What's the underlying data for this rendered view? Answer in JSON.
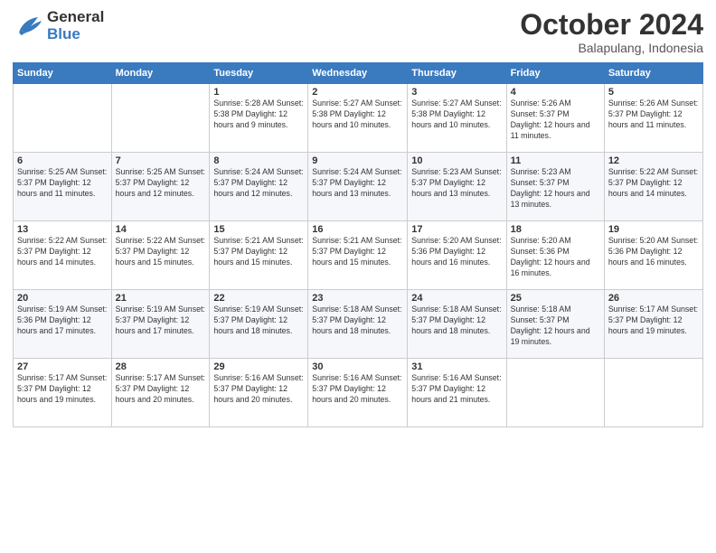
{
  "header": {
    "logo_line1": "General",
    "logo_line2": "Blue",
    "month": "October 2024",
    "location": "Balapulang, Indonesia"
  },
  "weekdays": [
    "Sunday",
    "Monday",
    "Tuesday",
    "Wednesday",
    "Thursday",
    "Friday",
    "Saturday"
  ],
  "weeks": [
    [
      {
        "day": "",
        "info": ""
      },
      {
        "day": "",
        "info": ""
      },
      {
        "day": "1",
        "info": "Sunrise: 5:28 AM\nSunset: 5:38 PM\nDaylight: 12 hours and 9 minutes."
      },
      {
        "day": "2",
        "info": "Sunrise: 5:27 AM\nSunset: 5:38 PM\nDaylight: 12 hours and 10 minutes."
      },
      {
        "day": "3",
        "info": "Sunrise: 5:27 AM\nSunset: 5:38 PM\nDaylight: 12 hours and 10 minutes."
      },
      {
        "day": "4",
        "info": "Sunrise: 5:26 AM\nSunset: 5:37 PM\nDaylight: 12 hours and 11 minutes."
      },
      {
        "day": "5",
        "info": "Sunrise: 5:26 AM\nSunset: 5:37 PM\nDaylight: 12 hours and 11 minutes."
      }
    ],
    [
      {
        "day": "6",
        "info": "Sunrise: 5:25 AM\nSunset: 5:37 PM\nDaylight: 12 hours and 11 minutes."
      },
      {
        "day": "7",
        "info": "Sunrise: 5:25 AM\nSunset: 5:37 PM\nDaylight: 12 hours and 12 minutes."
      },
      {
        "day": "8",
        "info": "Sunrise: 5:24 AM\nSunset: 5:37 PM\nDaylight: 12 hours and 12 minutes."
      },
      {
        "day": "9",
        "info": "Sunrise: 5:24 AM\nSunset: 5:37 PM\nDaylight: 12 hours and 13 minutes."
      },
      {
        "day": "10",
        "info": "Sunrise: 5:23 AM\nSunset: 5:37 PM\nDaylight: 12 hours and 13 minutes."
      },
      {
        "day": "11",
        "info": "Sunrise: 5:23 AM\nSunset: 5:37 PM\nDaylight: 12 hours and 13 minutes."
      },
      {
        "day": "12",
        "info": "Sunrise: 5:22 AM\nSunset: 5:37 PM\nDaylight: 12 hours and 14 minutes."
      }
    ],
    [
      {
        "day": "13",
        "info": "Sunrise: 5:22 AM\nSunset: 5:37 PM\nDaylight: 12 hours and 14 minutes."
      },
      {
        "day": "14",
        "info": "Sunrise: 5:22 AM\nSunset: 5:37 PM\nDaylight: 12 hours and 15 minutes."
      },
      {
        "day": "15",
        "info": "Sunrise: 5:21 AM\nSunset: 5:37 PM\nDaylight: 12 hours and 15 minutes."
      },
      {
        "day": "16",
        "info": "Sunrise: 5:21 AM\nSunset: 5:37 PM\nDaylight: 12 hours and 15 minutes."
      },
      {
        "day": "17",
        "info": "Sunrise: 5:20 AM\nSunset: 5:36 PM\nDaylight: 12 hours and 16 minutes."
      },
      {
        "day": "18",
        "info": "Sunrise: 5:20 AM\nSunset: 5:36 PM\nDaylight: 12 hours and 16 minutes."
      },
      {
        "day": "19",
        "info": "Sunrise: 5:20 AM\nSunset: 5:36 PM\nDaylight: 12 hours and 16 minutes."
      }
    ],
    [
      {
        "day": "20",
        "info": "Sunrise: 5:19 AM\nSunset: 5:36 PM\nDaylight: 12 hours and 17 minutes."
      },
      {
        "day": "21",
        "info": "Sunrise: 5:19 AM\nSunset: 5:37 PM\nDaylight: 12 hours and 17 minutes."
      },
      {
        "day": "22",
        "info": "Sunrise: 5:19 AM\nSunset: 5:37 PM\nDaylight: 12 hours and 18 minutes."
      },
      {
        "day": "23",
        "info": "Sunrise: 5:18 AM\nSunset: 5:37 PM\nDaylight: 12 hours and 18 minutes."
      },
      {
        "day": "24",
        "info": "Sunrise: 5:18 AM\nSunset: 5:37 PM\nDaylight: 12 hours and 18 minutes."
      },
      {
        "day": "25",
        "info": "Sunrise: 5:18 AM\nSunset: 5:37 PM\nDaylight: 12 hours and 19 minutes."
      },
      {
        "day": "26",
        "info": "Sunrise: 5:17 AM\nSunset: 5:37 PM\nDaylight: 12 hours and 19 minutes."
      }
    ],
    [
      {
        "day": "27",
        "info": "Sunrise: 5:17 AM\nSunset: 5:37 PM\nDaylight: 12 hours and 19 minutes."
      },
      {
        "day": "28",
        "info": "Sunrise: 5:17 AM\nSunset: 5:37 PM\nDaylight: 12 hours and 20 minutes."
      },
      {
        "day": "29",
        "info": "Sunrise: 5:16 AM\nSunset: 5:37 PM\nDaylight: 12 hours and 20 minutes."
      },
      {
        "day": "30",
        "info": "Sunrise: 5:16 AM\nSunset: 5:37 PM\nDaylight: 12 hours and 20 minutes."
      },
      {
        "day": "31",
        "info": "Sunrise: 5:16 AM\nSunset: 5:37 PM\nDaylight: 12 hours and 21 minutes."
      },
      {
        "day": "",
        "info": ""
      },
      {
        "day": "",
        "info": ""
      }
    ]
  ]
}
